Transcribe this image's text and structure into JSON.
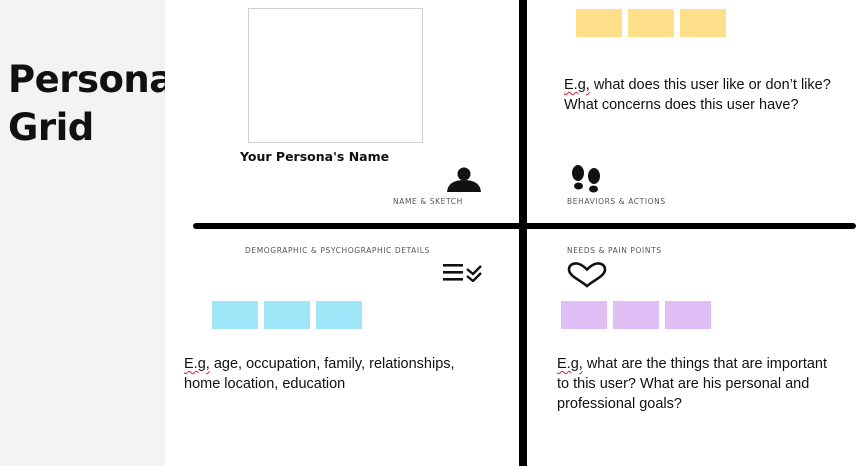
{
  "title": {
    "line1": "Persona",
    "line2": "Grid"
  },
  "name_sketch": {
    "persona_name": "Your Persona's Name",
    "label": "NAME & SKETCH",
    "icon": "person-icon"
  },
  "behaviors": {
    "label": "BEHAVIORS & ACTIONS",
    "icon": "footprints-icon",
    "text_prefix": "E.g,",
    "text_line1": " what does this user like or don’t like?",
    "text_line2": "What concerns does this user have?",
    "note_color": "#ffe08a"
  },
  "demographics": {
    "label": "DEMOGRAPHIC & PSYCHOGRAPHIC DETAILS",
    "icon": "list-check-icon",
    "text_prefix": "E.g,",
    "text_line1": " age, occupation, family, relationships,",
    "text_line2": "home location, education",
    "note_color": "#9fe7f8"
  },
  "needs": {
    "label": "NEEDS & PAIN POINTS",
    "icon": "heart-icon",
    "text_prefix": "E.g,",
    "text_line1": " what are the things that are important",
    "text_line2": "to this user? What are his personal and",
    "text_line3": "professional goals?",
    "note_color": "#dfbff5"
  }
}
